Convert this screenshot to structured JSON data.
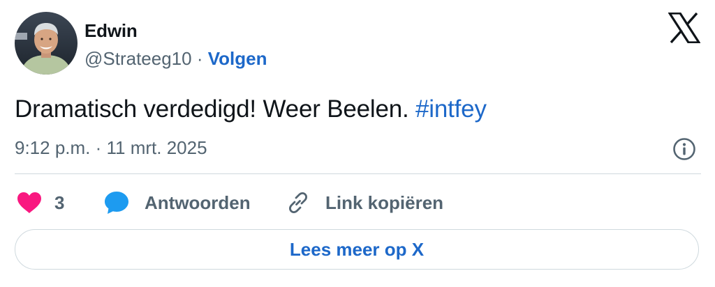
{
  "author": {
    "name": "Edwin",
    "handle": "@Strateeg10",
    "separator": "·",
    "follow_label": "Volgen"
  },
  "tweet": {
    "text": "Dramatisch verdedigd! Weer Beelen. ",
    "hashtag": "#intfey",
    "timestamp": "9:12 p.m. · 11 mrt. 2025"
  },
  "actions": {
    "like_count": "3",
    "reply_label": "Antwoorden",
    "copy_link_label": "Link kopiëren"
  },
  "read_more_label": "Lees meer op X",
  "icons": {
    "logo": "x-logo-icon",
    "info": "info-icon",
    "like": "heart-icon",
    "reply": "speech-bubble-icon",
    "link": "link-icon"
  },
  "colors": {
    "accent_blue": "#1d68c9",
    "like_pink": "#f91880",
    "reply_blue": "#1d9bf0",
    "muted_text": "#536471",
    "border": "#cfd9de"
  }
}
